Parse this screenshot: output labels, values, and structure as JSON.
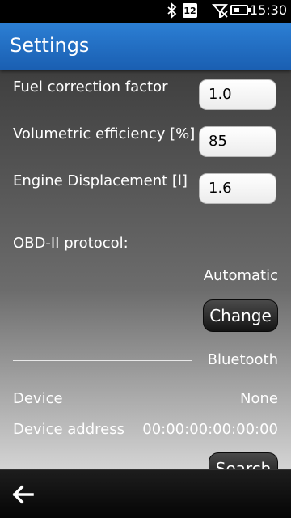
{
  "status_bar": {
    "calendar_day": "12",
    "time": "15:30",
    "icons": [
      "bluetooth-icon",
      "calendar-icon",
      "no-signal-icon",
      "battery-icon"
    ]
  },
  "header": {
    "title": "Settings"
  },
  "settings": {
    "fuel_correction": {
      "label": "Fuel correction factor",
      "value": "1.0"
    },
    "volumetric_efficiency": {
      "label": "Volumetric efficiency [%]",
      "value": "85"
    },
    "engine_displacement": {
      "label": "Engine Displacement [l]",
      "value": "1.6"
    }
  },
  "obd": {
    "label": "OBD-II protocol:",
    "value": "Automatic",
    "change_label": "Change"
  },
  "bluetooth": {
    "section_label": "Bluetooth",
    "device_label": "Device",
    "device_value": "None",
    "address_label": "Device address",
    "address_value": "00:00:00:00:00:00",
    "search_label": "Search"
  },
  "toolbar": {
    "back_icon": "back-arrow-icon"
  },
  "colors": {
    "header_blue": "#1a5fb2",
    "background_dark": "#3f3f3f"
  }
}
